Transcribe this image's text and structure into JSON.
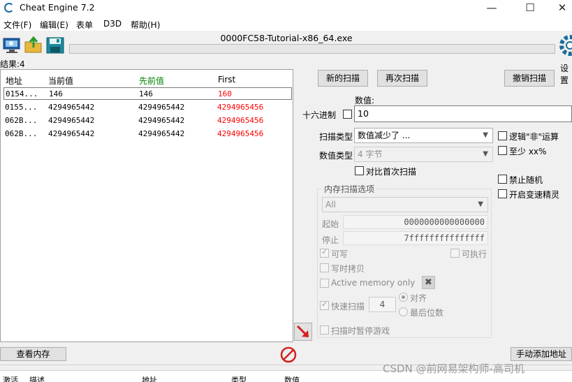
{
  "window": {
    "title": "Cheat Engine 7.2",
    "minimize": "—",
    "maximize": "☐",
    "close": "✕"
  },
  "menu": [
    "文件(F)",
    "编辑(E)",
    "表单",
    "D3D",
    "帮助(H)"
  ],
  "process_name": "0000FC58-Tutorial-x86_64.exe",
  "settings_label": "设置",
  "found_label": "结果:4",
  "results": {
    "columns": [
      "地址",
      "当前值",
      "先前值",
      "First"
    ],
    "rows": [
      [
        "0154...",
        "146",
        "146",
        "160"
      ],
      [
        "0155...",
        "4294965442",
        "4294965442",
        "4294965456"
      ],
      [
        "062B...",
        "4294965442",
        "4294965442",
        "4294965456"
      ],
      [
        "062B...",
        "4294965442",
        "4294965442",
        "4294965456"
      ]
    ]
  },
  "scan": {
    "new_scan": "新的扫描",
    "next_scan": "再次扫描",
    "undo_scan": "撤销扫描",
    "value_label": "数值:",
    "hex_label": "十六进制",
    "value": "10",
    "scan_type_label": "扫描类型",
    "scan_type_value": "数值减少了 ...",
    "value_type_label": "数值类型",
    "value_type_value": "4 字节",
    "compare_first": "对比首次扫描",
    "logic_not": "逻辑\"非\"运算",
    "at_least": "至少 xx%",
    "no_random": "禁止随机",
    "speedhack": "开启变速精灵"
  },
  "memory": {
    "group_title": "内存扫描选项",
    "region": "All",
    "start_label": "起始",
    "start_value": "0000000000000000",
    "stop_label": "停止",
    "stop_value": "7fffffffffffffff",
    "writable": "可写",
    "executable": "可执行",
    "copy_on_write": "写时拷贝",
    "active_only": "Active memory only",
    "fast_scan": "快速扫描",
    "fast_scan_value": "4",
    "align": "对齐",
    "last_digits": "最后位数",
    "pause_game": "扫描时暂停游戏"
  },
  "bottom": {
    "view_memory": "查看内存",
    "add_address": "手动添加地址",
    "columns": [
      "激活",
      "描述",
      "地址",
      "类型",
      "数值"
    ]
  },
  "watermark": "CSDN @前网易架构师-高司机",
  "colors": {
    "previous_header": "#008000",
    "first_values": "#ff0000",
    "logo_blue": "#1a6c9c"
  }
}
